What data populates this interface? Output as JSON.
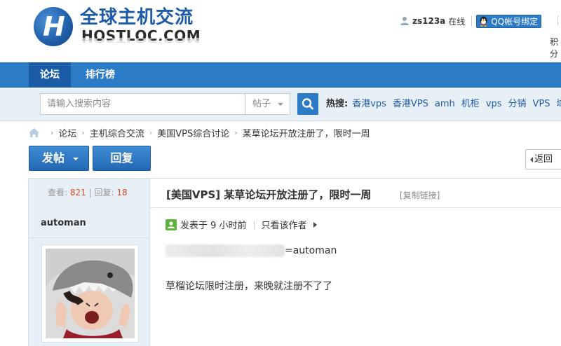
{
  "logo": {
    "cn": "全球主机交流",
    "en": "HOSTLOC.COM",
    "reflection": "HOSTLOC.COM"
  },
  "user": {
    "name": "zs123a",
    "status": "在线",
    "qq_bind_label": "QQ帐号绑定",
    "score_label_partial": "积分"
  },
  "nav": {
    "items": [
      {
        "label": "论坛",
        "active": true
      },
      {
        "label": "排行榜",
        "active": false
      }
    ]
  },
  "search": {
    "placeholder": "请输入搜索内容",
    "type_selected": "帖子",
    "hot_label": "热搜:",
    "hot_links": [
      "香港vps",
      "香港VPS",
      "amh",
      "机柜",
      "vps",
      "分销",
      "VPS",
      "域名"
    ]
  },
  "breadcrumb": [
    "论坛",
    "主机综合交流",
    "美国VPS综合讨论",
    "某草论坛开放注册了，限时一周"
  ],
  "actions": {
    "post_label": "发帖",
    "reply_label": "回复",
    "back_label": "返回"
  },
  "thread": {
    "views_label": "查看:",
    "views": "821",
    "replies_label": "回复:",
    "replies": "18",
    "title": "[美国VPS] 某草论坛开放注册了，限时一周",
    "copy_link": "[复制链接]"
  },
  "post": {
    "author": "automan",
    "posted_at": "发表于 9 小时前",
    "only_author": "只看该作者",
    "redacted_suffix": "=automan",
    "body": "草榴论坛限时注册，来晚就注册不了了"
  },
  "colors": {
    "brand_blue": "#2b7bc7",
    "nav_active": "#1a5da6",
    "link": "#1f5aa6",
    "count_highlight": "#e04b1f",
    "panel_bg": "#e8f0f7"
  }
}
